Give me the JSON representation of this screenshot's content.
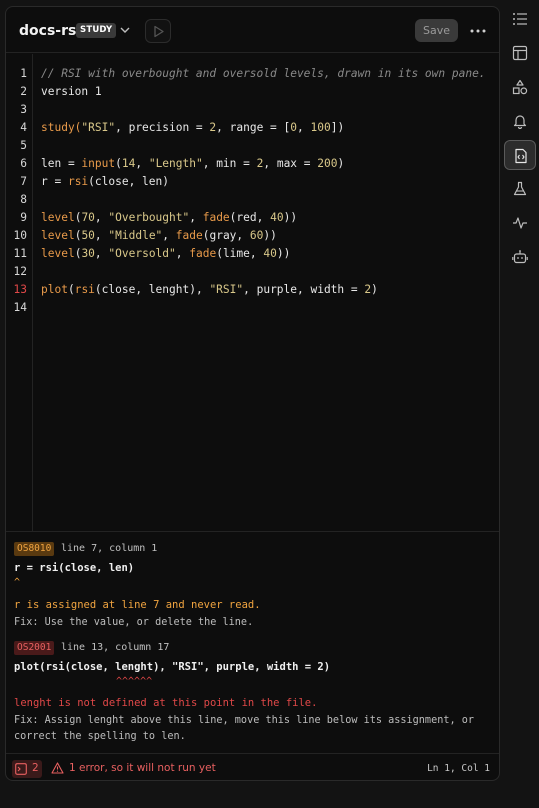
{
  "header": {
    "script_name": "docs-rsi",
    "badge": "STUDY",
    "save_label": "Save"
  },
  "editor": {
    "lines": [
      {
        "no": "1",
        "error": false
      },
      {
        "no": "2",
        "error": false
      },
      {
        "no": "3",
        "error": false
      },
      {
        "no": "4",
        "error": false
      },
      {
        "no": "5",
        "error": false
      },
      {
        "no": "6",
        "error": false
      },
      {
        "no": "7",
        "error": false
      },
      {
        "no": "8",
        "error": false
      },
      {
        "no": "9",
        "error": false
      },
      {
        "no": "10",
        "error": false
      },
      {
        "no": "11",
        "error": false
      },
      {
        "no": "12",
        "error": false
      },
      {
        "no": "13",
        "error": true
      },
      {
        "no": "14",
        "error": false
      }
    ],
    "code": {
      "l1": "// RSI with overbought and oversold levels, drawn in its own pane.",
      "l2": "version 1",
      "l4a": "study(",
      "l4b": "\"RSI\"",
      "l4c": ", precision = ",
      "l4d": "2",
      "l4e": ", range = [",
      "l4f": "0",
      "l4g": ", ",
      "l4h": "100",
      "l4i": "])",
      "l6a": "len = ",
      "l6b": "input",
      "l6c": "(",
      "l6d": "14",
      "l6e": ", ",
      "l6f": "\"Length\"",
      "l6g": ", min = ",
      "l6h": "2",
      "l6i": ", max = ",
      "l6j": "200",
      "l6k": ")",
      "l7a": "r = ",
      "l7b": "rsi",
      "l7c": "(close, len)",
      "l9a": "level",
      "l9b": "(",
      "l9c": "70",
      "l9d": ", ",
      "l9e": "\"Overbought\"",
      "l9f": ", ",
      "l9g": "fade",
      "l9h": "(red, ",
      "l9i": "40",
      "l9j": "))",
      "l10a": "level",
      "l10b": "(",
      "l10c": "50",
      "l10d": ", ",
      "l10e": "\"Middle\"",
      "l10f": ", ",
      "l10g": "fade",
      "l10h": "(gray, ",
      "l10i": "60",
      "l10j": "))",
      "l11a": "level",
      "l11b": "(",
      "l11c": "30",
      "l11d": ", ",
      "l11e": "\"Oversold\"",
      "l11f": ", ",
      "l11g": "fade",
      "l11h": "(lime, ",
      "l11i": "40",
      "l11j": "))",
      "l13a": "plot",
      "l13b": "(",
      "l13c": "rsi",
      "l13d": "(close, lenght), ",
      "l13e": "\"RSI\"",
      "l13f": ", purple, width = ",
      "l13g": "2",
      "l13h": ")"
    }
  },
  "problems": [
    {
      "code": "OS8010",
      "severity": "warning",
      "location": "line 7, column 1",
      "source": "r = rsi(close, len)",
      "caret": "^",
      "message": "r is assigned at line 7 and never read.",
      "fix": "Fix: Use the value, or delete the line."
    },
    {
      "code": "OS2001",
      "severity": "error",
      "location": "line 13, column 17",
      "source": "plot(rsi(close, lenght), \"RSI\", purple, width = 2)",
      "caret": "^^^^^^",
      "message": "lenght is not defined at this point in the file.",
      "fix": "Fix: Assign lenght above this line, move this line below its assignment, or correct the spelling to len."
    }
  ],
  "status": {
    "problem_count": "2",
    "message": "1 error, so it will not run yet",
    "cursor": "Ln 1, Col 1"
  },
  "rail": {
    "icons": [
      "list-icon",
      "table-icon",
      "shapes-icon",
      "bell-icon",
      "code-file-icon",
      "flask-icon",
      "pulse-icon",
      "robot-icon"
    ],
    "active": "code-file-icon"
  },
  "colors": {
    "accent_warning": "#f0a440",
    "accent_error": "#e04848",
    "function": "#e89a4a",
    "string": "#d9c88a"
  }
}
